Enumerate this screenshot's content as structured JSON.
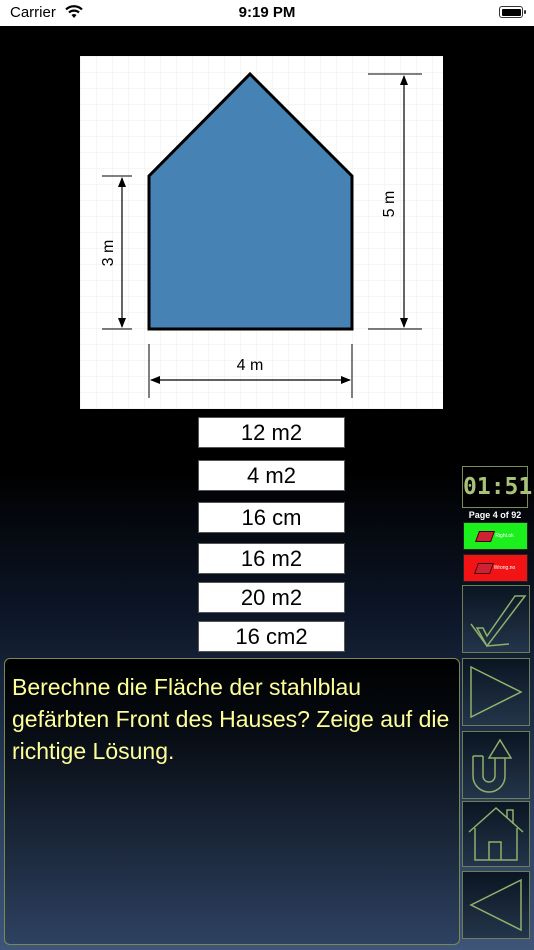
{
  "status_bar": {
    "carrier": "Carrier",
    "time": "9:19 PM"
  },
  "figure": {
    "width_label": "4 m",
    "height_label": "5 m",
    "wall_label": "3 m",
    "fill_color": "#4682b4"
  },
  "answers": [
    {
      "label": "12 m2"
    },
    {
      "label": "4 m2"
    },
    {
      "label": "16 cm"
    },
    {
      "label": "16 m2"
    },
    {
      "label": "20 m2"
    },
    {
      "label": "16 cm2"
    }
  ],
  "timer": "01:51",
  "page_indicator": "Page 4 of 92",
  "status_buttons": {
    "correct_label": "Right.ok",
    "wrong_label": "Wrong.no"
  },
  "question": "Berechne die Fläche der stahlblau gefärbten Front des Hauses? Zeige auf die richtige Lösung.",
  "nav_icons": [
    "checkmark-icon",
    "play-icon",
    "undo-icon",
    "home-icon",
    "back-icon"
  ],
  "colors": {
    "accent": "#a8c27a",
    "question_text": "#ffff99",
    "correct": "#1cf01c",
    "wrong": "#f21414"
  }
}
